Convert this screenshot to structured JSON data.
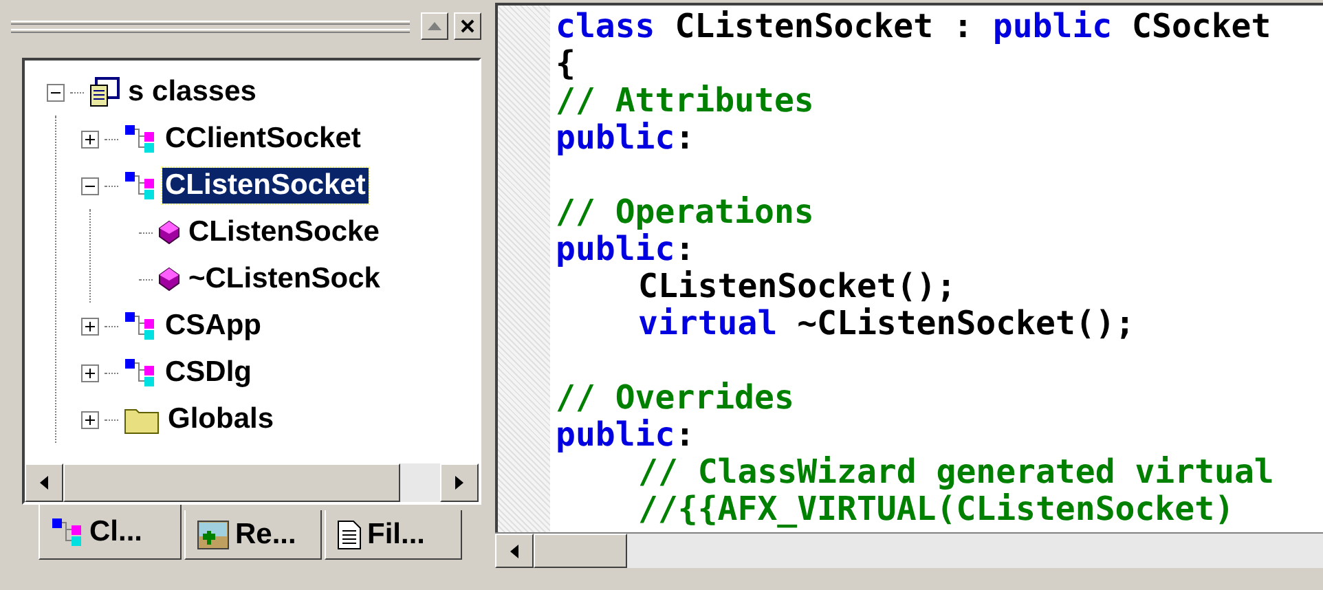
{
  "tree": [
    {
      "label": "s classes",
      "kind": "project",
      "expanded": true,
      "selected": false,
      "children": [
        {
          "label": "CClientSocket",
          "kind": "class",
          "expanded": false,
          "selected": false
        },
        {
          "label": "CListenSocket",
          "kind": "class",
          "expanded": true,
          "selected": true,
          "children": [
            {
              "label": "CListenSocke",
              "kind": "method",
              "selected": false
            },
            {
              "label": "~CListenSock",
              "kind": "method",
              "selected": false
            }
          ]
        },
        {
          "label": "CSApp",
          "kind": "class",
          "expanded": false,
          "selected": false
        },
        {
          "label": "CSDlg",
          "kind": "class",
          "expanded": false,
          "selected": false
        },
        {
          "label": "Globals",
          "kind": "folder",
          "expanded": false,
          "selected": false
        }
      ]
    }
  ],
  "tabs": [
    {
      "label": "Cl...",
      "kind": "class",
      "selected": true
    },
    {
      "label": "Re...",
      "kind": "resource",
      "selected": false
    },
    {
      "label": "Fil...",
      "kind": "file",
      "selected": false
    }
  ],
  "code": [
    {
      "indent": false,
      "parts": [
        {
          "kind": "keyword",
          "text": "class"
        },
        {
          "kind": "plain",
          "text": " CListenSocket : "
        },
        {
          "kind": "keyword",
          "text": "public"
        },
        {
          "kind": "plain",
          "text": " CSocket"
        }
      ]
    },
    {
      "indent": false,
      "parts": [
        {
          "kind": "plain",
          "text": "{"
        }
      ]
    },
    {
      "indent": false,
      "parts": [
        {
          "kind": "comment",
          "text": "// Attributes"
        }
      ]
    },
    {
      "indent": false,
      "parts": [
        {
          "kind": "keyword",
          "text": "public"
        },
        {
          "kind": "plain",
          "text": ":"
        }
      ]
    },
    {
      "kind": "blank"
    },
    {
      "indent": false,
      "parts": [
        {
          "kind": "comment",
          "text": "// Operations"
        }
      ]
    },
    {
      "indent": false,
      "parts": [
        {
          "kind": "keyword",
          "text": "public"
        },
        {
          "kind": "plain",
          "text": ":"
        }
      ]
    },
    {
      "indent": true,
      "parts": [
        {
          "kind": "plain",
          "text": "CListenSocket();"
        }
      ]
    },
    {
      "indent": true,
      "parts": [
        {
          "kind": "keyword",
          "text": "virtual"
        },
        {
          "kind": "plain",
          "text": " ~CListenSocket();"
        }
      ]
    },
    {
      "kind": "blank"
    },
    {
      "indent": false,
      "parts": [
        {
          "kind": "comment",
          "text": "// Overrides"
        }
      ]
    },
    {
      "indent": false,
      "parts": [
        {
          "kind": "keyword",
          "text": "public"
        },
        {
          "kind": "plain",
          "text": ":"
        }
      ]
    },
    {
      "indent": true,
      "parts": [
        {
          "kind": "comment",
          "text": "// ClassWizard generated virtual"
        }
      ]
    },
    {
      "indent": true,
      "parts": [
        {
          "kind": "comment",
          "text": "//{{AFX_VIRTUAL(CListenSocket)"
        }
      ]
    }
  ]
}
